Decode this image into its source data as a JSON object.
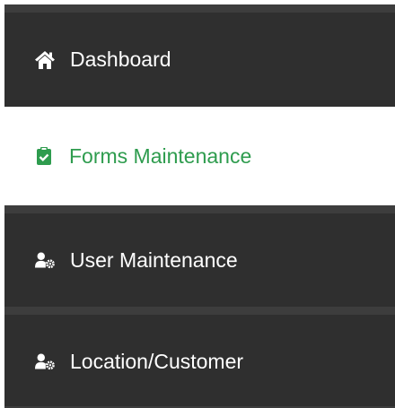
{
  "menu": {
    "items": [
      {
        "label": "Dashboard",
        "icon": "home-icon",
        "active": false
      },
      {
        "label": "Forms Maintenance",
        "icon": "clipboard-check-icon",
        "active": true
      },
      {
        "label": "User Maintenance",
        "icon": "user-gear-icon",
        "active": false
      },
      {
        "label": "Location/Customer",
        "icon": "user-gear-icon",
        "active": false
      }
    ]
  },
  "colors": {
    "menu_background": "#2f2f2f",
    "separator": "#3d3d3d",
    "active_background": "#ffffff",
    "active_text": "#2e9c4e",
    "text": "#ffffff"
  }
}
